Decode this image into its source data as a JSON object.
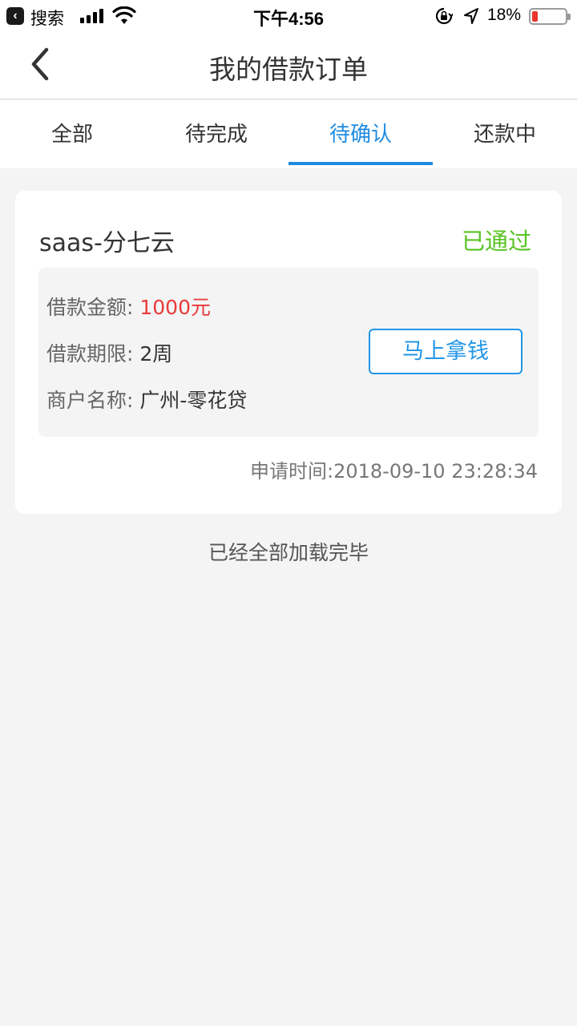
{
  "status_bar": {
    "back_app": "搜索",
    "time": "下午4:56",
    "battery": "18%",
    "battery_level": 0.18,
    "icons": [
      "back-app-icon",
      "signal-icon",
      "wifi-icon",
      "orientation-lock-icon",
      "location-icon",
      "battery-icon"
    ]
  },
  "nav": {
    "title": "我的借款订单",
    "back_icon": "chevron-left-icon"
  },
  "tabs": [
    {
      "label": "全部",
      "active": false
    },
    {
      "label": "待完成",
      "active": false
    },
    {
      "label": "待确认",
      "active": true
    },
    {
      "label": "还款中",
      "active": false
    }
  ],
  "colors": {
    "accent": "#1e8be0",
    "status_green": "#58c322",
    "amount_red": "#e83a3a",
    "background": "#f4f4f4"
  },
  "order": {
    "title": "saas-分七云",
    "status": "已通过",
    "amount_label": "借款金额: ",
    "amount_value": "1000元",
    "term_label": "借款期限: ",
    "term_value": "2周",
    "merchant_label": "商户名称: ",
    "merchant_value": "广州-零花贷",
    "action_button": "马上拿钱",
    "apply_time": "申请时间:2018-09-10 23:28:34"
  },
  "footer": {
    "text": "已经全部加载完毕"
  }
}
